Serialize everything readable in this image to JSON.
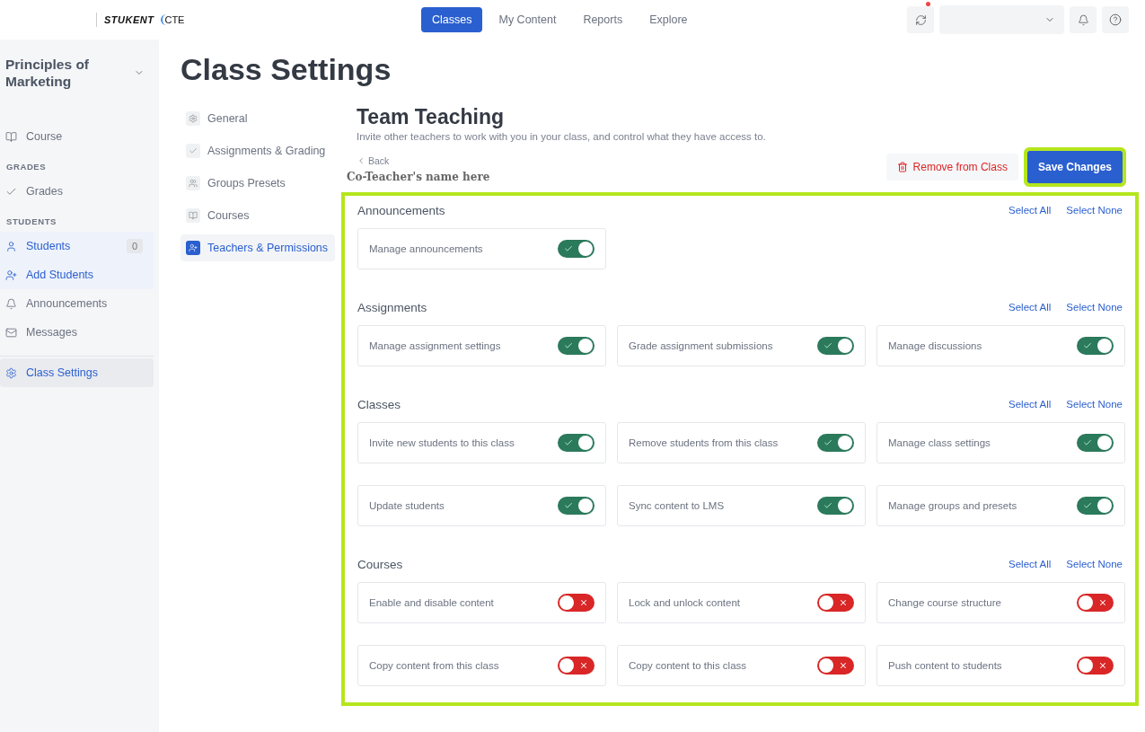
{
  "logo": {
    "brand": "STUKENT",
    "suffix": "CTE"
  },
  "nav_tabs": [
    {
      "label": "Classes",
      "selected": true
    },
    {
      "label": "My Content",
      "selected": false
    },
    {
      "label": "Reports",
      "selected": false
    },
    {
      "label": "Explore",
      "selected": false
    }
  ],
  "header": {
    "notification": true
  },
  "sidebar": {
    "course_title": "Principles of Marketing",
    "items": [
      {
        "kind": "item",
        "label": "Course",
        "selected": false,
        "active": false
      },
      {
        "kind": "heading",
        "label": "GRADES"
      },
      {
        "kind": "item",
        "label": "Grades",
        "selected": false,
        "active": false
      },
      {
        "kind": "heading",
        "label": "STUDENTS"
      },
      {
        "kind": "item",
        "label": "Students",
        "count": "0",
        "selected": false,
        "active": true
      },
      {
        "kind": "item",
        "label": "Add Students",
        "selected": false,
        "active": true
      },
      {
        "kind": "item",
        "label": "Announcements",
        "selected": false,
        "active": false
      },
      {
        "kind": "item",
        "label": "Messages",
        "selected": false,
        "active": false
      },
      {
        "kind": "divider"
      },
      {
        "kind": "item",
        "label": "Class Settings",
        "selected": true,
        "active": false
      }
    ]
  },
  "page_title": "Class Settings",
  "settings_nav": [
    {
      "label": "General",
      "selected": false
    },
    {
      "label": "Assignments & Grading",
      "selected": false
    },
    {
      "label": "Groups Presets",
      "selected": false
    },
    {
      "label": "Courses",
      "selected": false
    },
    {
      "label": "Teachers & Permissions",
      "selected": true
    }
  ],
  "panel": {
    "title": "Team Teaching",
    "subtitle": "Invite other teachers to work with you in your class, and control what they have access to.",
    "back": "Back",
    "teacher_name": "Co-Teacher's name here",
    "remove_button": "Remove from Class",
    "save_button": "Save Changes"
  },
  "sections": [
    {
      "title": "Announcements",
      "select_all": "Select All",
      "select_none": "Select None",
      "permissions": [
        {
          "label": "Manage announcements",
          "on": true
        }
      ]
    },
    {
      "title": "Assignments",
      "select_all": "Select All",
      "select_none": "Select None",
      "permissions": [
        {
          "label": "Manage assignment settings",
          "on": true
        },
        {
          "label": "Grade assignment submissions",
          "on": true
        },
        {
          "label": "Manage discussions",
          "on": true
        }
      ]
    },
    {
      "title": "Classes",
      "select_all": "Select All",
      "select_none": "Select None",
      "permissions": [
        {
          "label": "Invite new students to this class",
          "on": true
        },
        {
          "label": "Remove students from this class",
          "on": true
        },
        {
          "label": "Manage class settings",
          "on": true
        },
        {
          "label": "Update students",
          "on": true
        },
        {
          "label": "Sync content to LMS",
          "on": true
        },
        {
          "label": "Manage groups and presets",
          "on": true
        }
      ]
    },
    {
      "title": "Courses",
      "select_all": "Select All",
      "select_none": "Select None",
      "permissions": [
        {
          "label": "Enable and disable content",
          "on": false
        },
        {
          "label": "Lock and unlock content",
          "on": false
        },
        {
          "label": "Change course structure",
          "on": false
        },
        {
          "label": "Copy content from this class",
          "on": false
        },
        {
          "label": "Copy content to this class",
          "on": false
        },
        {
          "label": "Push content to students",
          "on": false
        }
      ]
    }
  ]
}
